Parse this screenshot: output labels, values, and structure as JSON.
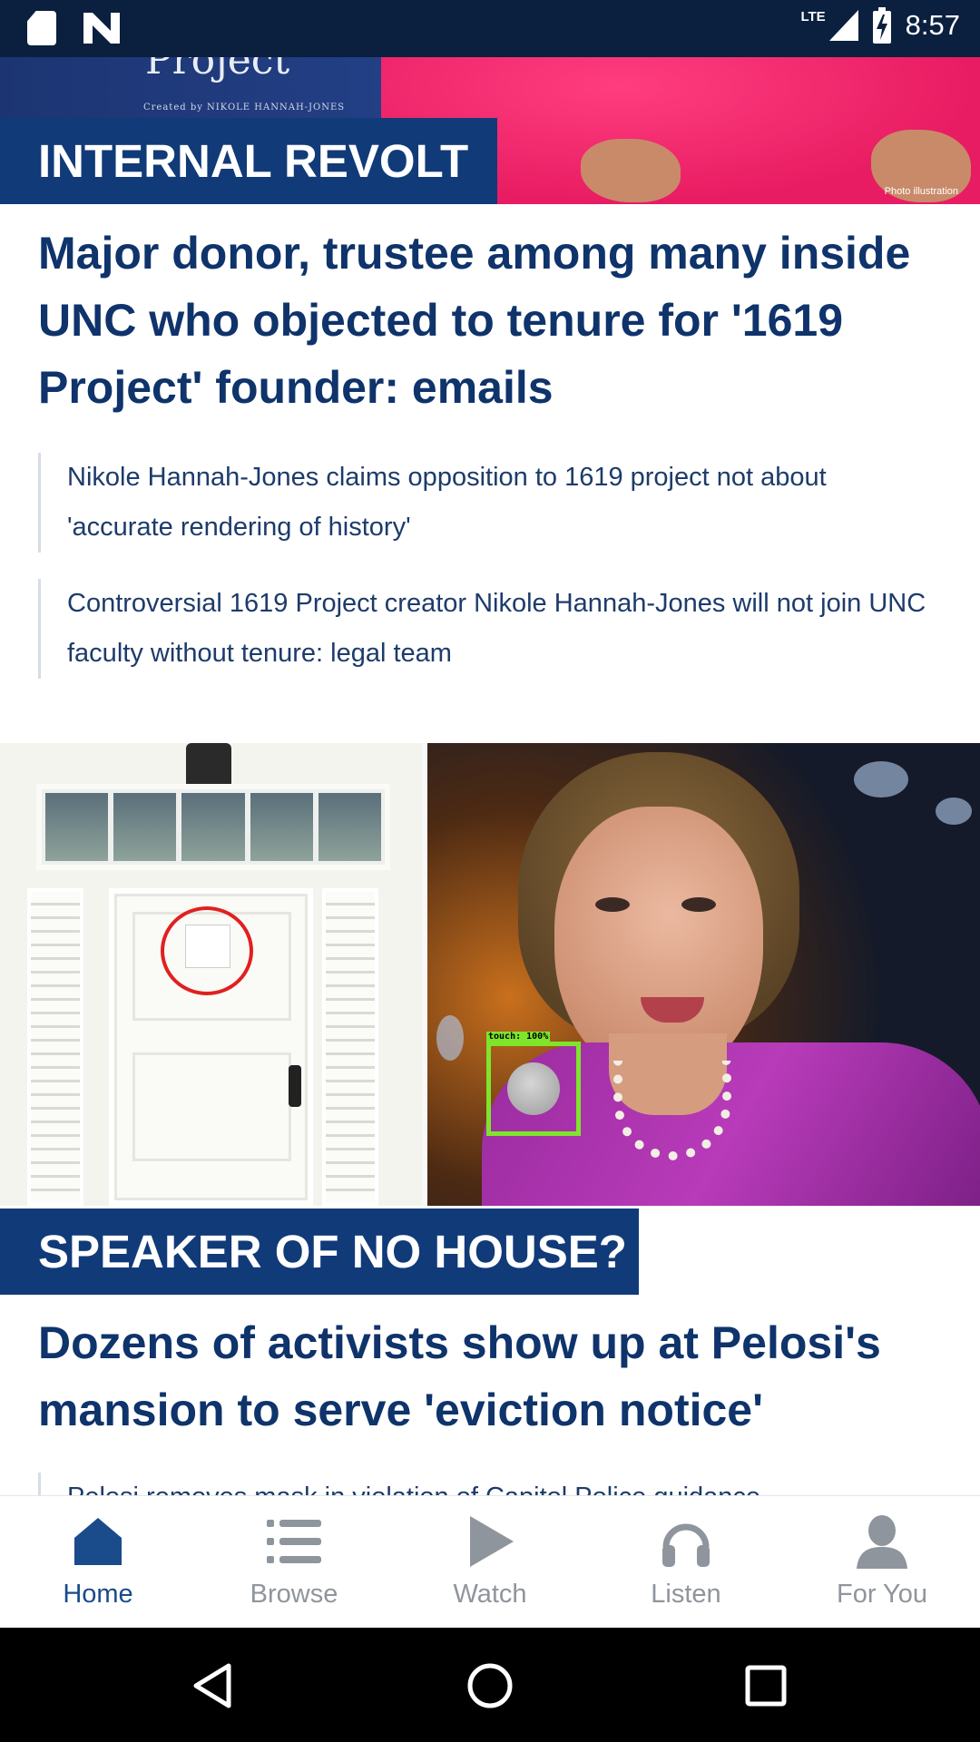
{
  "status_bar": {
    "time": "8:57",
    "network": "LTE",
    "icons": [
      "sd-card-icon",
      "news-app-icon",
      "signal-icon",
      "battery-charging-icon"
    ]
  },
  "articles": [
    {
      "kicker": "INTERNAL REVOLT",
      "headline": "Major donor, trustee among many inside UNC who objected to tenure for '1619 Project' founder: emails",
      "image": {
        "book_text": "Project",
        "credit": "Created by NIKOLE HANNAH-JONES",
        "note": "Photo illustration"
      },
      "related": [
        "Nikole Hannah-Jones claims opposition to 1619 project not about 'accurate rendering of history'",
        "Controversial 1619 Project creator Nikole Hannah-Jones will not join UNC faculty without tenure: legal team"
      ]
    },
    {
      "kicker": "SPEAKER OF NO HOUSE?",
      "headline": "Dozens of activists show up at Pelosi's mansion to serve 'eviction notice'",
      "related": [
        "Pelosi removes mask in violation of Capitol Police guidance"
      ]
    }
  ],
  "touch_overlay": {
    "label": "touch: 100%"
  },
  "bottom_nav": {
    "items": [
      {
        "label": "Home",
        "icon": "home-icon",
        "active": true
      },
      {
        "label": "Browse",
        "icon": "list-icon",
        "active": false
      },
      {
        "label": "Watch",
        "icon": "play-icon",
        "active": false
      },
      {
        "label": "Listen",
        "icon": "headphones-icon",
        "active": false
      },
      {
        "label": "For You",
        "icon": "person-icon",
        "active": false
      }
    ],
    "active_color": "#1a4b8a",
    "inactive_color": "#8f959c"
  },
  "colors": {
    "status_bar": "#0b1f3f",
    "kicker_bg": "#113a78",
    "headline": "#0f336b",
    "touch_box": "#7ee52b"
  }
}
